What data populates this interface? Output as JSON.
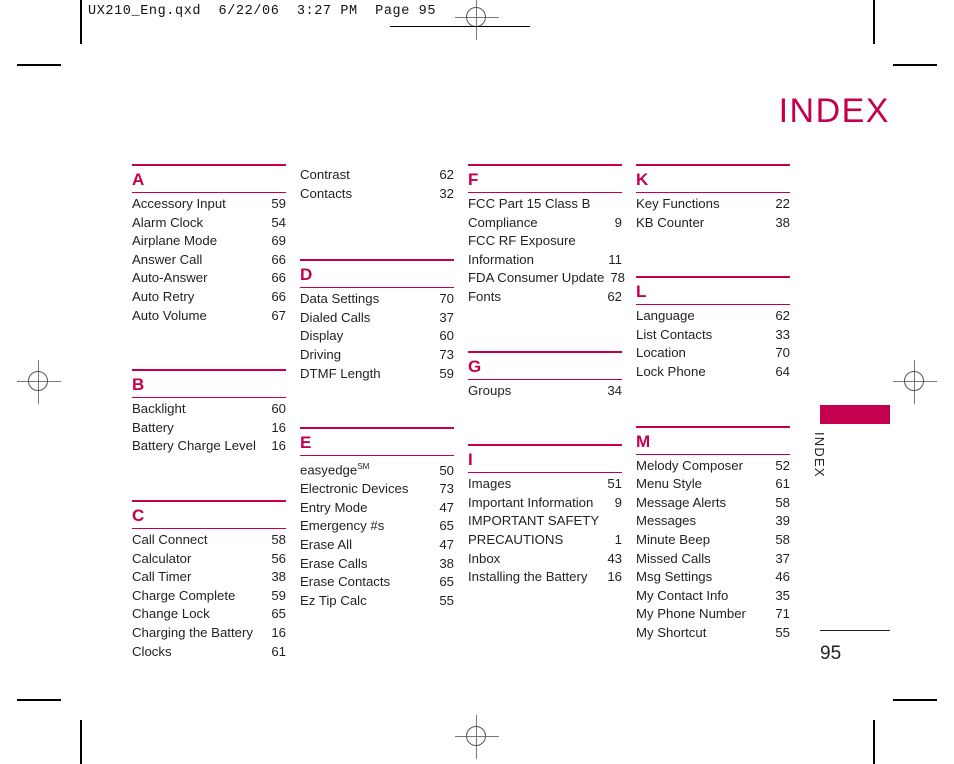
{
  "header": {
    "file_line": "UX210_Eng.qxd  6/22/06  3:27 PM  Page 95"
  },
  "page_title": "INDEX",
  "side_tab": {
    "label": "INDEX"
  },
  "folio": "95",
  "colors": {
    "accent": "#c4004e",
    "text": "#231f20"
  },
  "columns": [
    {
      "id": "column-1",
      "groups": [
        {
          "letter": "A",
          "entries": [
            {
              "title": "Accessory Input",
              "page": "59"
            },
            {
              "title": "Alarm Clock",
              "page": "54"
            },
            {
              "title": "Airplane Mode",
              "page": "69"
            },
            {
              "title": "Answer Call",
              "page": "66"
            },
            {
              "title": "Auto-Answer",
              "page": "66"
            },
            {
              "title": "Auto Retry",
              "page": "66"
            },
            {
              "title": "Auto Volume",
              "page": "67"
            }
          ]
        },
        {
          "letter": "B",
          "entries": [
            {
              "title": "Backlight",
              "page": "60"
            },
            {
              "title": "Battery",
              "page": "16"
            },
            {
              "title": "Battery Charge Level",
              "page": "16"
            }
          ]
        },
        {
          "letter": "C",
          "entries": [
            {
              "title": "Call Connect",
              "page": "58"
            },
            {
              "title": "Calculator",
              "page": "56"
            },
            {
              "title": "Call Timer",
              "page": "38"
            },
            {
              "title": "Charge Complete",
              "page": "59"
            },
            {
              "title": "Change Lock",
              "page": "65"
            },
            {
              "title": "Charging the Battery",
              "page": "16"
            },
            {
              "title": "Clocks",
              "page": "61"
            }
          ]
        }
      ]
    },
    {
      "id": "column-2",
      "groups": [
        {
          "letter": "",
          "entries": [
            {
              "title": "Contrast",
              "page": "62"
            },
            {
              "title": "Contacts",
              "page": "32"
            }
          ]
        },
        {
          "letter": "D",
          "entries": [
            {
              "title": "Data Settings",
              "page": "70"
            },
            {
              "title": "Dialed Calls",
              "page": "37"
            },
            {
              "title": "Display",
              "page": "60"
            },
            {
              "title": "Driving",
              "page": "73"
            },
            {
              "title": "DTMF Length",
              "page": "59"
            }
          ]
        },
        {
          "letter": "E",
          "entries": [
            {
              "title": "easyedge",
              "page": "50",
              "superscript": "SM"
            },
            {
              "title": "Electronic Devices",
              "page": "73"
            },
            {
              "title": "Entry Mode",
              "page": "47"
            },
            {
              "title": "Emergency #s",
              "page": "65"
            },
            {
              "title": "Erase All",
              "page": "47"
            },
            {
              "title": "Erase Calls",
              "page": "38"
            },
            {
              "title": "Erase Contacts",
              "page": "65"
            },
            {
              "title": "Ez Tip Calc",
              "page": "55"
            }
          ]
        }
      ]
    },
    {
      "id": "column-3",
      "groups": [
        {
          "letter": "F",
          "entries": [
            {
              "title": "FCC Part 15 Class B",
              "page": "",
              "wrapped": true
            },
            {
              "title": "Compliance",
              "page": "9"
            },
            {
              "title": "FCC RF Exposure",
              "page": "",
              "wrapped": true
            },
            {
              "title": "Information",
              "page": "11"
            },
            {
              "title": "FDA Consumer Update",
              "page": "78"
            },
            {
              "title": "Fonts",
              "page": "62"
            }
          ]
        },
        {
          "letter": "G",
          "entries": [
            {
              "title": "Groups",
              "page": "34"
            }
          ]
        },
        {
          "letter": "I",
          "entries": [
            {
              "title": "Images",
              "page": "51"
            },
            {
              "title": "Important Information",
              "page": "9"
            },
            {
              "title": "IMPORTANT SAFETY",
              "page": "",
              "wrapped": true
            },
            {
              "title": "PRECAUTIONS",
              "page": "1"
            },
            {
              "title": "Inbox",
              "page": "43"
            },
            {
              "title": "Installing the Battery",
              "page": "16"
            }
          ]
        }
      ]
    },
    {
      "id": "column-4",
      "groups": [
        {
          "letter": "K",
          "entries": [
            {
              "title": "Key Functions",
              "page": "22"
            },
            {
              "title": "KB Counter",
              "page": "38"
            }
          ]
        },
        {
          "letter": "L",
          "entries": [
            {
              "title": "Language",
              "page": "62"
            },
            {
              "title": "List Contacts",
              "page": "33"
            },
            {
              "title": "Location",
              "page": "70"
            },
            {
              "title": "Lock Phone",
              "page": "64"
            }
          ]
        },
        {
          "letter": "M",
          "entries": [
            {
              "title": "Melody Composer",
              "page": "52"
            },
            {
              "title": "Menu Style",
              "page": "61"
            },
            {
              "title": "Message Alerts",
              "page": "58"
            },
            {
              "title": "Messages",
              "page": "39"
            },
            {
              "title": "Minute Beep",
              "page": "58"
            },
            {
              "title": "Missed Calls",
              "page": "37"
            },
            {
              "title": "Msg Settings",
              "page": "46"
            },
            {
              "title": "My Contact Info",
              "page": "35"
            },
            {
              "title": "My Phone Number",
              "page": "71"
            },
            {
              "title": "My Shortcut",
              "page": "55"
            }
          ]
        }
      ]
    }
  ]
}
